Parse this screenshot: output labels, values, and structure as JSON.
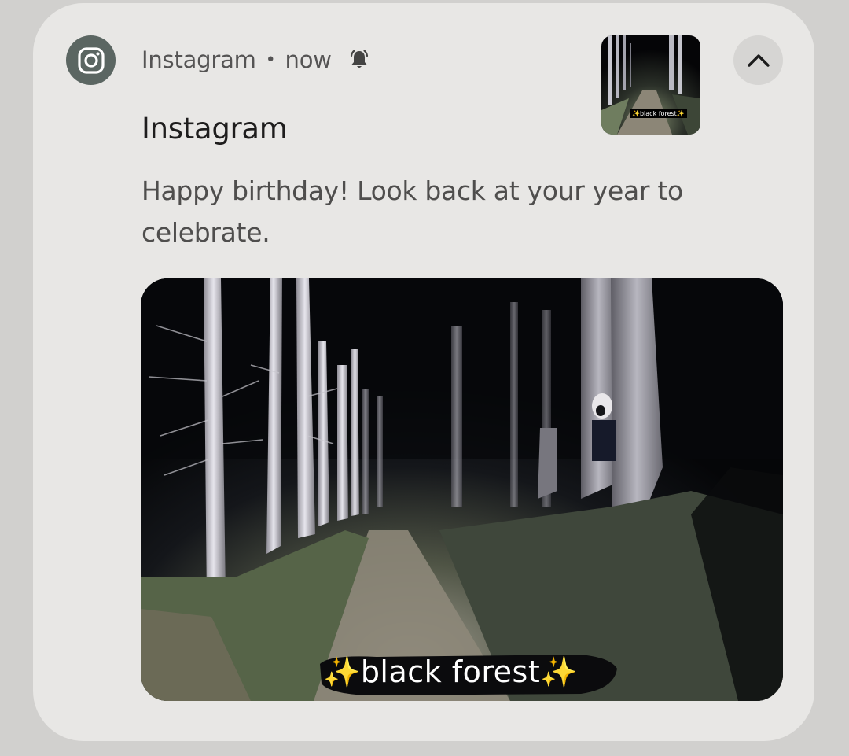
{
  "notification": {
    "app_name": "Instagram",
    "separator": "•",
    "time": "now",
    "title": "Instagram",
    "message": "Happy birthday! Look back at your year to celebrate.",
    "image_caption": "✨black forest✨",
    "thumbnail_caption": "✨black forest✨",
    "icons": {
      "app": "instagram-icon",
      "alert": "bell-alert-icon",
      "expand": "chevron-up-icon"
    }
  },
  "colors": {
    "card_background": "#e8e7e5",
    "app_icon_background": "#5b6662",
    "title_text": "#1e1d1d",
    "body_text": "#4f4e4d"
  }
}
